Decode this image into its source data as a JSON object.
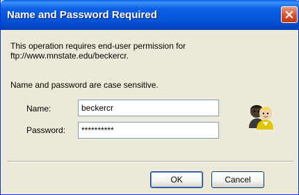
{
  "dialog": {
    "title": "Name and Password Required",
    "message_line1": "This operation requires end-user permission for",
    "message_line2": "ftp://www.mnstate.edu/beckercr.",
    "note": "Name and password are case sensitive."
  },
  "form": {
    "name_label": "Name:",
    "name_value": "beckercr",
    "password_label": "Password:",
    "password_value": "**********"
  },
  "buttons": {
    "ok_label": "OK",
    "cancel_label": "Cancel"
  },
  "colors": {
    "titlebar": "#0a5fe6",
    "close": "#d8502c",
    "dialog_bg": "#ece9d8"
  },
  "icons": {
    "close": "close-icon",
    "users": "users-icon"
  }
}
